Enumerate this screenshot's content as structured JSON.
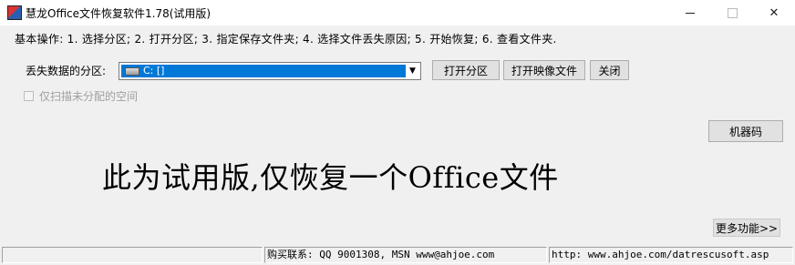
{
  "window": {
    "title": "慧龙Office文件恢复软件1.78(试用版)",
    "minimize_glyph": "",
    "maximize_glyph": "",
    "close_glyph": "✕"
  },
  "steps_text": "基本操作: 1. 选择分区; 2. 打开分区; 3. 指定保存文件夹; 4. 选择文件丢失原因; 5. 开始恢复; 6. 查看文件夹.",
  "partition": {
    "label": "丢失数据的分区:",
    "selected": "C:  []",
    "icon": "drive-icon"
  },
  "buttons": {
    "open_partition": "打开分区",
    "open_image": "打开映像文件",
    "close": "关闭",
    "machine_code": "机器码",
    "more": "更多功能>>"
  },
  "scan_unallocated": {
    "label": "仅扫描未分配的空间",
    "checked": false,
    "enabled": false
  },
  "trial_notice": "此为试用版,仅恢复一个Office文件",
  "status": {
    "cell1": "",
    "cell2": "购买联系: QQ 9001308, MSN www@ahjoe.com",
    "cell3": "http: www.ahjoe.com/datrescusoft.asp"
  }
}
